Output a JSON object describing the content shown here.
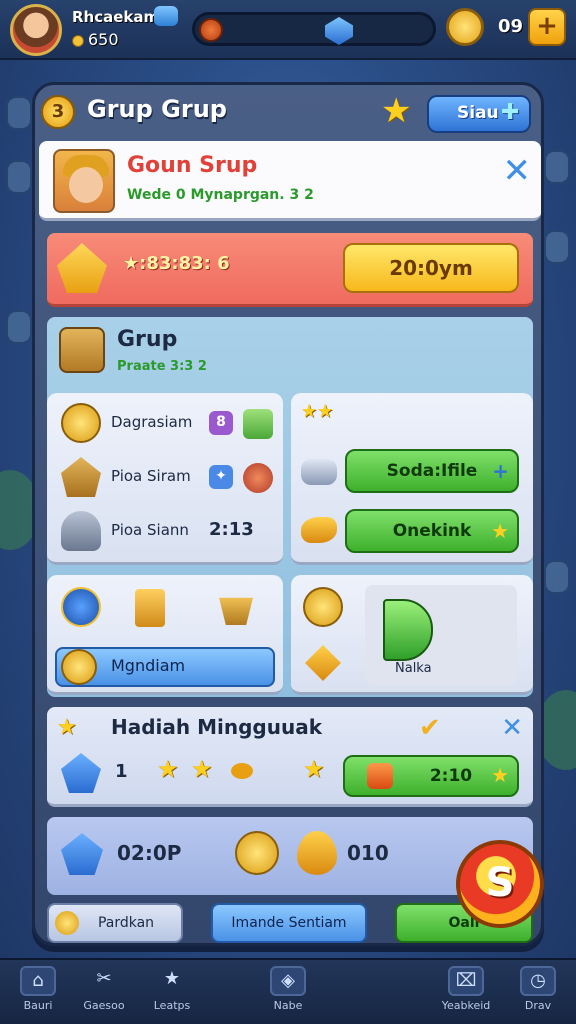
{
  "hud": {
    "player_name": "Rhcaekam",
    "player_coins": "650",
    "gold_count": "09",
    "plus": "+"
  },
  "panel": {
    "title_coin": "3",
    "title": "Grup Grup",
    "siau_button": "Siau",
    "group": {
      "name": "Goun Srup",
      "sub": "Wede 0 Mynaprgan. 3 2"
    },
    "red_row": {
      "timer": "★:83:83: 6",
      "button": "20:0ym"
    },
    "group_section": {
      "title": "Grup",
      "sub": "Praate 3:3 2"
    },
    "list": [
      {
        "label": "Dagrasiam"
      },
      {
        "label": "Pioa Siram"
      },
      {
        "label": "Pioa Siann",
        "value": "2:13"
      }
    ],
    "right_buttons": [
      {
        "label": "Soda:Ifile",
        "icon": "+"
      },
      {
        "label": "Onekink",
        "icon": "★"
      }
    ],
    "mid_left_button": "Mgndiam",
    "mid_right_label": "Nalka",
    "weekly": {
      "title": "Hadiah Mingguuak",
      "count": "1",
      "button": "2:10"
    },
    "bottom_row": {
      "time": "02:0P",
      "value": "010"
    },
    "footer": {
      "left": "Pardkan",
      "middle": "Imande Sentiam",
      "right": "Oali"
    },
    "big_token": "S"
  },
  "nav": [
    {
      "label": "Bauri",
      "icon": "house-icon"
    },
    {
      "label": "Gaesoo",
      "icon": "tools-icon"
    },
    {
      "label": "Leatps",
      "icon": "star-icon"
    },
    {
      "label": "Nabe",
      "icon": "shield-icon"
    },
    {
      "label": "Yeabkeid",
      "icon": "gift-icon"
    },
    {
      "label": "Drav",
      "icon": "clock-icon"
    }
  ],
  "colors": {
    "accent_green": "#3eb02c",
    "accent_red": "#ef6b5f",
    "accent_yellow": "#f7b81c",
    "accent_blue": "#4a92e6"
  }
}
